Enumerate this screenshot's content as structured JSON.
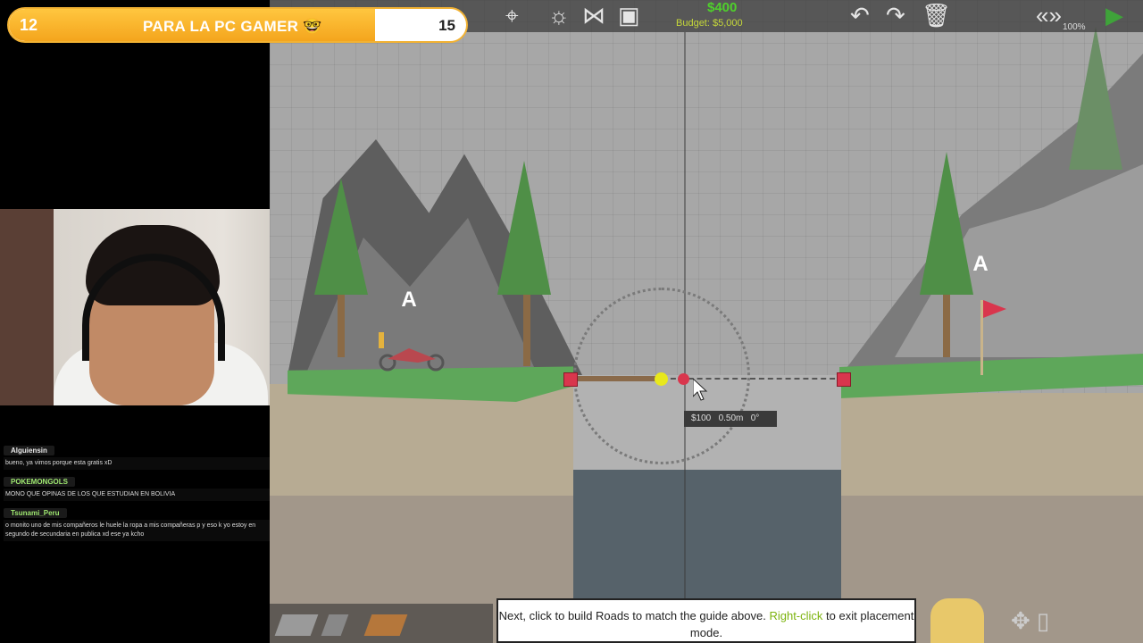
{
  "stream": {
    "goal": {
      "start": "12",
      "title": "PARA LA PC GAMER 🤓",
      "end": "15",
      "progress": 0.8
    },
    "chat": [
      {
        "user": "Alguiensin",
        "text": "bueno, ya vimos porque esta gratis xD"
      },
      {
        "user": "POKEMONGOLS",
        "text": "MONO QUE OPINAS DE LOS QUE ESTUDIAN EN BOLIVIA"
      },
      {
        "user": "Tsunami_Peru",
        "text": "o monito uno de mis compañeros le huele la ropa a mis compañeras p y eso k yo estoy en segundo de secundaria en publica xd ese ya kcho"
      }
    ]
  },
  "game": {
    "cost": "$400",
    "budget": "Budget: $5,000",
    "zoom": "100%",
    "toolbar_icons": [
      "binoculars-icon",
      "lightbulb-icon",
      "nodes-icon",
      "camera-icon",
      "undo-icon",
      "redo-icon",
      "trash-icon",
      "chevrons-icon",
      "play-icon"
    ],
    "signs": [
      "A",
      "A"
    ],
    "tooltip": {
      "cost": "$100",
      "length": "0.50m",
      "angle": "0°"
    },
    "hint": {
      "part1": "Next, click to build Roads to match the guide above.",
      "highlight": "Right-click",
      "part2": "to exit placement mode."
    },
    "colors": {
      "cost_green": "#4fd12b",
      "anchor_red": "#d9364d",
      "joint_yellow": "#e8e81c",
      "hint_highlight": "#7cb30d"
    }
  }
}
